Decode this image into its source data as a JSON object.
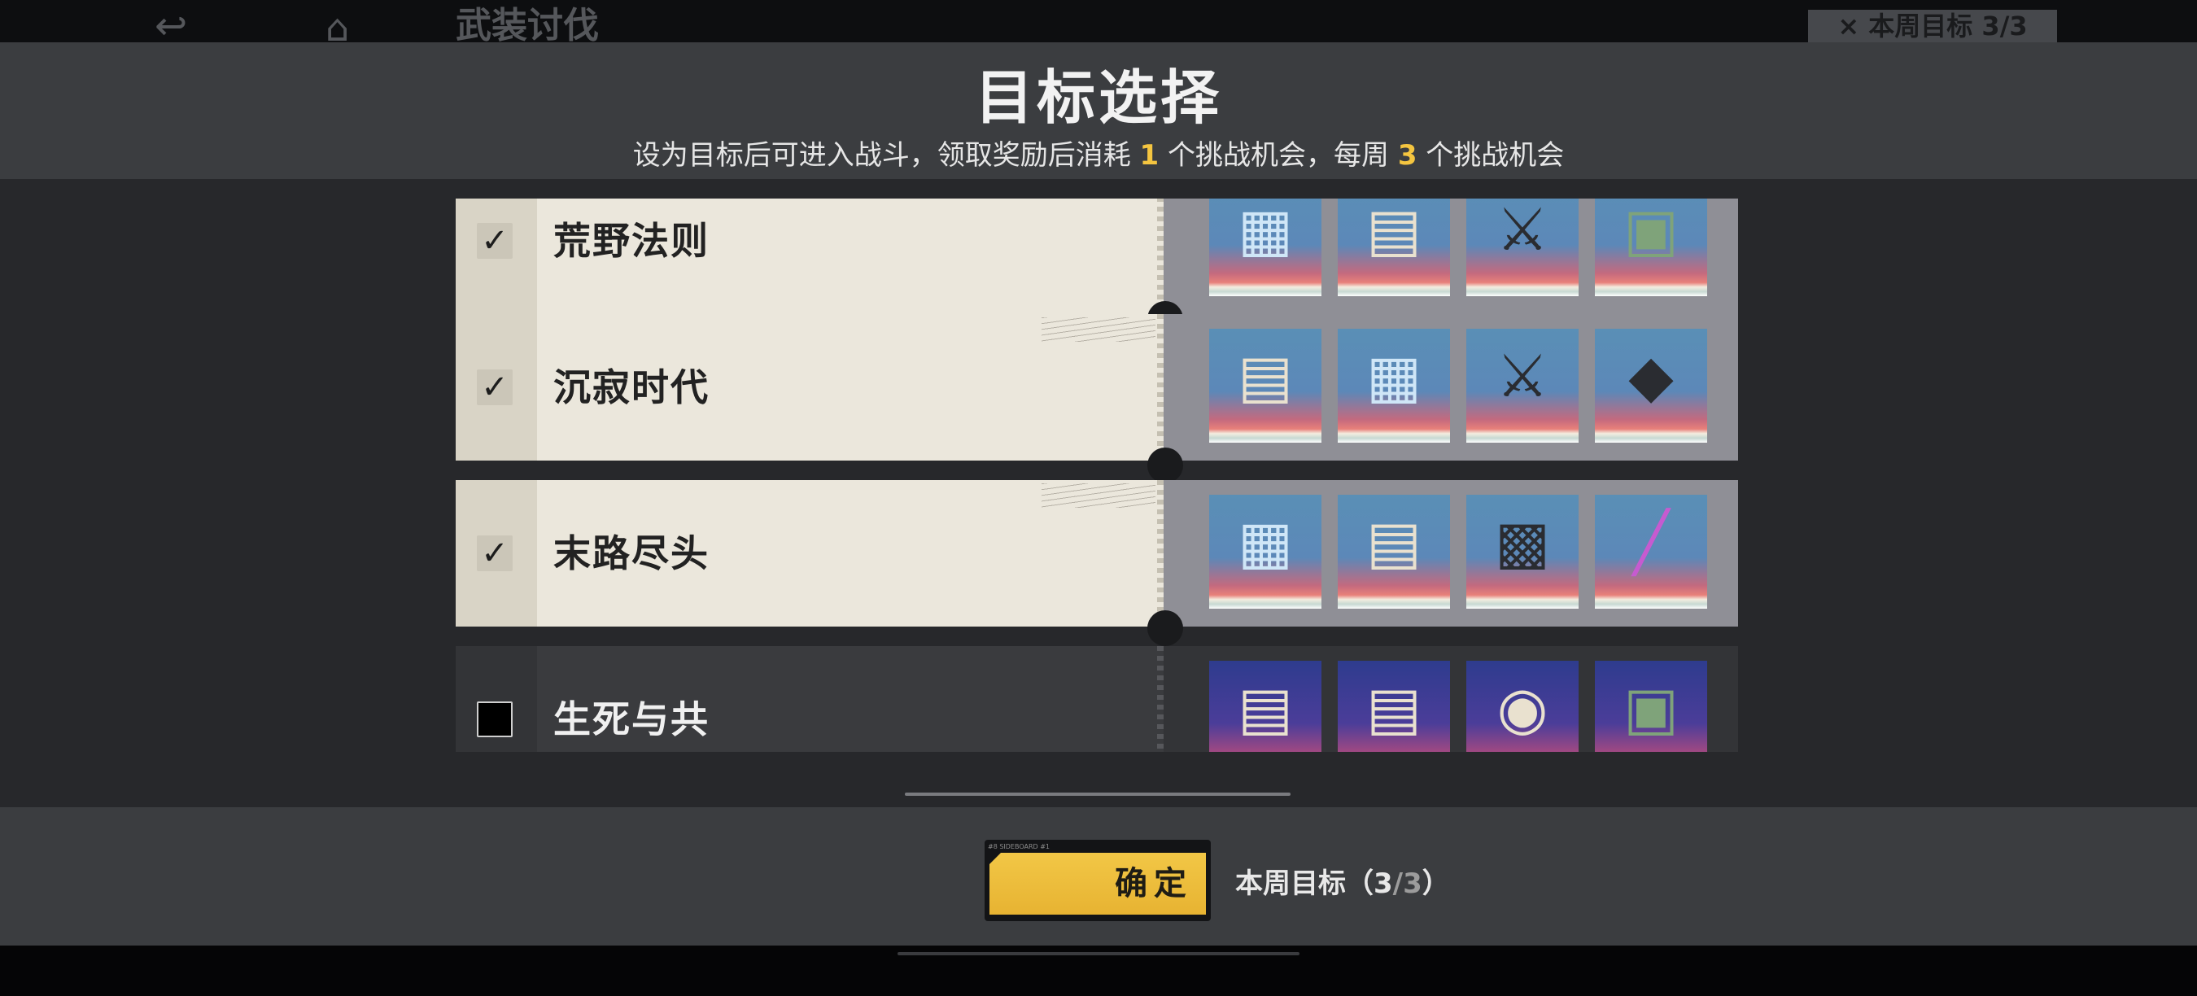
{
  "background": {
    "back_glyph": "↩",
    "home_glyph": "⌂",
    "title": "武装讨伐",
    "weekly_badge": "× 本周目标 3/3"
  },
  "dialog": {
    "title": "目标选择",
    "subtitle_prefix": "设为目标后可进入战斗，领取奖励后消耗",
    "subtitle_num1": "1",
    "subtitle_mid": "个挑战机会，每周",
    "subtitle_num2": "3",
    "subtitle_suffix": "个挑战机会"
  },
  "stages": [
    {
      "name": "荒野法则",
      "selected": true,
      "check_glyph": "✓",
      "rewards": [
        {
          "icon": "blueprint-icon",
          "glyph": "▦",
          "tile": "blue"
        },
        {
          "icon": "manual-icon",
          "glyph": "▤",
          "tile": "blue"
        },
        {
          "icon": "weapon-icon",
          "glyph": "⚔",
          "tile": "blue"
        },
        {
          "icon": "green-gun-icon",
          "glyph": "▣",
          "tile": "blue"
        }
      ]
    },
    {
      "name": "沉寂时代",
      "selected": true,
      "check_glyph": "✓",
      "rewards": [
        {
          "icon": "manual-icon",
          "glyph": "▤",
          "tile": "blue"
        },
        {
          "icon": "blueprint-icon",
          "glyph": "▦",
          "tile": "blue"
        },
        {
          "icon": "rifle-icon",
          "glyph": "⚔",
          "tile": "blue"
        },
        {
          "icon": "blade-icon",
          "glyph": "◆",
          "tile": "blue"
        }
      ]
    },
    {
      "name": "末路尽头",
      "selected": true,
      "check_glyph": "✓",
      "rewards": [
        {
          "icon": "blueprint-icon",
          "glyph": "▦",
          "tile": "blue"
        },
        {
          "icon": "manual-icon",
          "glyph": "▤",
          "tile": "blue"
        },
        {
          "icon": "cannon-icon",
          "glyph": "▩",
          "tile": "blue"
        },
        {
          "icon": "pink-blade-icon",
          "glyph": "╱",
          "tile": "blue"
        }
      ]
    },
    {
      "name": "生死与共",
      "selected": false,
      "check_glyph": "",
      "rewards": [
        {
          "icon": "manual-icon",
          "glyph": "▤",
          "tile": "purple"
        },
        {
          "icon": "manual-icon",
          "glyph": "▤",
          "tile": "purple"
        },
        {
          "icon": "drone-icon",
          "glyph": "◉",
          "tile": "purple"
        },
        {
          "icon": "turret-icon",
          "glyph": "▣",
          "tile": "purple"
        }
      ]
    }
  ],
  "footer": {
    "confirm_label": "确定",
    "confirm_stripe": "#8 SIDEBOARD   #1",
    "weekly_label": "本周目标",
    "weekly_open": "（",
    "weekly_current": "3",
    "weekly_sep": "/",
    "weekly_total": "3",
    "weekly_close": "）"
  },
  "colors": {
    "accent_yellow": "#f2c746",
    "selected_row": "#ebe7dc",
    "unselected_row": "#3a3b3e",
    "reward_panel": "#8f8f96"
  }
}
